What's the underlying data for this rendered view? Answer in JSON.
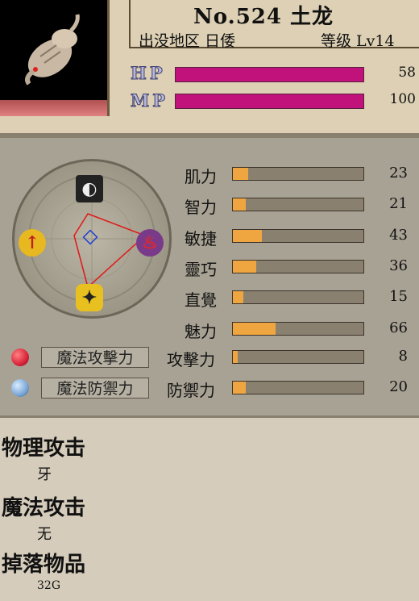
{
  "header": {
    "number_name": "No.524 土龙",
    "location_label": "出没地区 日倭",
    "level_label": "等级 Lv14"
  },
  "vitals": {
    "hp_label": "HP",
    "hp_value": "58",
    "mp_label": "MP",
    "mp_value": "100"
  },
  "stats": [
    {
      "label": "肌力",
      "value": "23",
      "fill": 0.12
    },
    {
      "label": "智力",
      "value": "21",
      "fill": 0.1
    },
    {
      "label": "敏捷",
      "value": "43",
      "fill": 0.22
    },
    {
      "label": "靈巧",
      "value": "36",
      "fill": 0.18
    },
    {
      "label": "直覺",
      "value": "15",
      "fill": 0.08
    },
    {
      "label": "魅力",
      "value": "66",
      "fill": 0.33
    }
  ],
  "combat": [
    {
      "button": "魔法攻擊力",
      "label": "攻擊力",
      "value": "8",
      "fill": 0.04,
      "orb_color": "#d8243a"
    },
    {
      "button": "魔法防禦力",
      "label": "防禦力",
      "value": "20",
      "fill": 0.1,
      "orb_color": "#7aa6d6"
    }
  ],
  "details": {
    "physical_attack_title": "物理攻击",
    "physical_attack_value": "牙",
    "magic_attack_title": "魔法攻击",
    "magic_attack_value": "无",
    "drop_title": "掉落物品",
    "drop_value": "32G"
  },
  "colors": {
    "hp_bar": "#c0127a",
    "stat_fill": "#f0a640",
    "radar_line": "#e01818",
    "center_marker": "#2040d0"
  },
  "icons": {
    "creature": "rat-creature-portrait",
    "wheel_top": "black-white-element-icon",
    "wheel_left": "yellow-red-element-icon",
    "wheel_right": "purple-red-element-icon",
    "wheel_bottom": "yellow-black-element-icon"
  }
}
